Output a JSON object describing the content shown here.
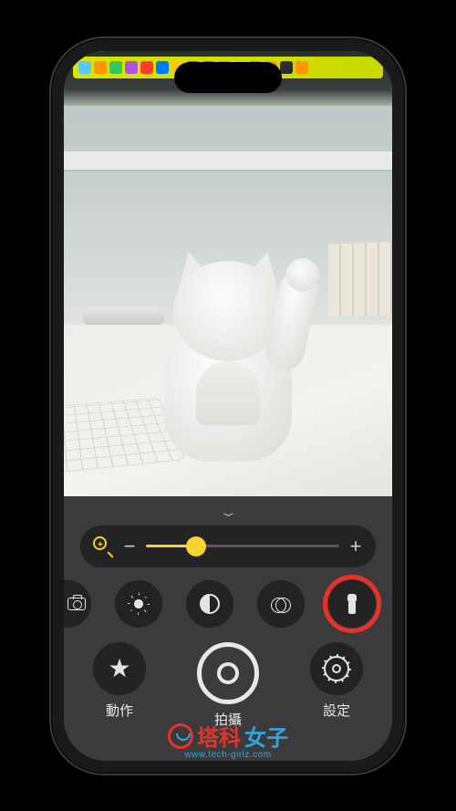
{
  "zoom": {
    "level_percent": 26
  },
  "toolbar": {
    "camera_switch": "camera-switch",
    "brightness": "brightness",
    "contrast": "contrast",
    "filters": "filters",
    "torch": "flashlight"
  },
  "bottom": {
    "activities_label": "動作",
    "capture_label": "拍攝",
    "settings_label": "設定"
  },
  "watermark": {
    "brand_red": "塔科",
    "brand_blue": "女子",
    "sub": "www.tech-girlz.com"
  }
}
